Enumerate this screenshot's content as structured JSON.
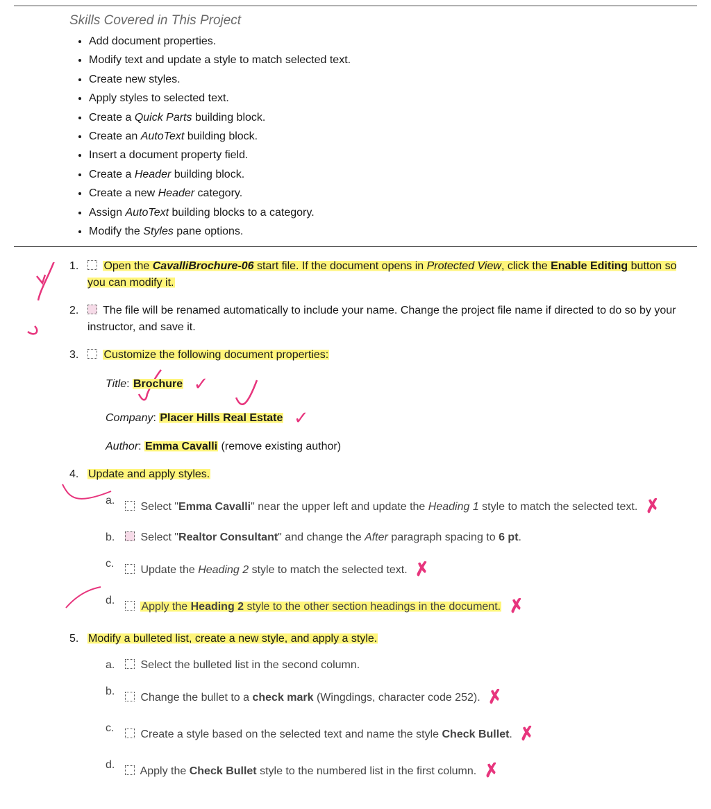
{
  "section_title": "Skills Covered in This Project",
  "skills": [
    {
      "pre": "Add document properties."
    },
    {
      "pre": "Modify text and update a style to match selected text."
    },
    {
      "pre": "Create new styles."
    },
    {
      "pre": "Apply styles to selected text."
    },
    {
      "pre": "Create a ",
      "em": "Quick Parts",
      "post": " building block."
    },
    {
      "pre": "Create an ",
      "em": "AutoText",
      "post": " building block."
    },
    {
      "pre": "Insert a document property field."
    },
    {
      "pre": "Create a ",
      "em": "Header",
      "post": " building block."
    },
    {
      "pre": "Create a new ",
      "em": "Header",
      "post": " category."
    },
    {
      "pre": "Assign ",
      "em": "AutoText",
      "post": " building blocks to a category."
    },
    {
      "pre": "Modify the ",
      "em": "Styles",
      "post": " pane options."
    }
  ],
  "steps": {
    "s1": {
      "a": "Open the ",
      "b": "CavalliBrochure-06",
      "c": " start file. If the document opens in ",
      "d": "Protected View",
      "e": ", click the ",
      "f": "Enable Editing",
      "g": " button so you can modify it."
    },
    "s2": "The file will be renamed automatically to include your name. Change the project file name if directed to do so by your instructor, and save it.",
    "s3": {
      "lead": "Customize the following document properties:",
      "title_label": "Title",
      "title_val": "Brochure",
      "company_label": "Company",
      "company_val": "Placer Hills Real Estate",
      "author_label": "Author",
      "author_val": "Emma Cavalli",
      "author_note": " (remove existing author)"
    },
    "s4": {
      "lead": "Update and apply styles.",
      "a": {
        "p1": "Select \"",
        "b1": "Emma Cavalli",
        "p2": "\" near the upper left and update the ",
        "i1": "Heading 1",
        "p3": " style to match the selected text."
      },
      "b": {
        "p1": "Select \"",
        "b1": "Realtor Consultant",
        "p2": "\" and change the ",
        "i1": "After",
        "p3": " paragraph spacing to ",
        "b2": "6 pt",
        "p4": "."
      },
      "c": {
        "p1": "Update the ",
        "i1": "Heading 2",
        "p2": " style to match the selected text."
      },
      "d": {
        "p1": "Apply the ",
        "b1": "Heading 2",
        "p2": " style to the other section headings in the document."
      }
    },
    "s5": {
      "lead": "Modify a bulleted list, create a new style, and apply a style.",
      "a": "Select the bulleted list in the second column.",
      "b": {
        "p1": "Change the bullet to a ",
        "b1": "check mark",
        "p2": " (Wingdings, character code 252)."
      },
      "c": {
        "p1": "Create a style based on the selected text and name the style ",
        "b1": "Check Bullet",
        "p2": "."
      },
      "d": {
        "p1": "Apply the ",
        "b1": "Check Bullet",
        "p2": " style to the numbered list in the first column."
      }
    }
  },
  "marks": {
    "x": "✗",
    "tick": "✓"
  }
}
